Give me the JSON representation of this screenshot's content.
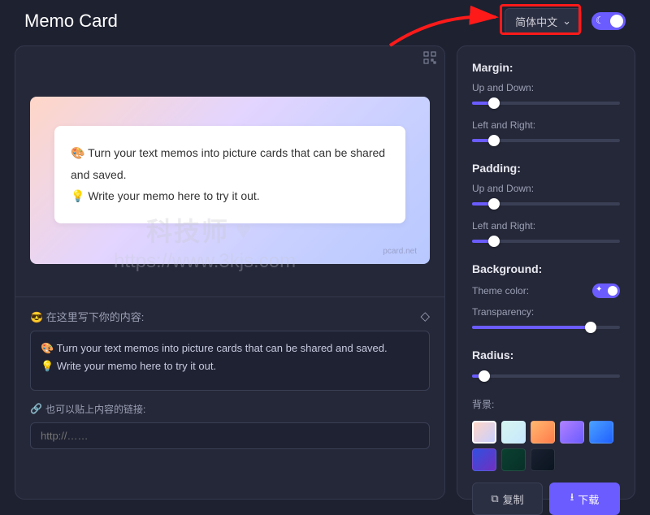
{
  "header": {
    "title": "Memo Card",
    "lang_label": "简体中文"
  },
  "preview": {
    "line1": "🎨 Turn your text memos into picture cards that can be shared and saved.",
    "line2": "💡 Write your memo here to try it out.",
    "watermark": "pcard.net"
  },
  "editor": {
    "label": "😎 在这里写下你的内容:",
    "content_line1": "🎨 Turn your text memos into picture cards that can be shared and saved.",
    "content_line2": "💡 Write your memo here to try it out.",
    "link_label": "也可以贴上内容的链接:",
    "link_placeholder": "http://……"
  },
  "settings": {
    "margin_title": "Margin:",
    "margin_ud_label": "Up and Down:",
    "margin_ud_value": 15,
    "margin_lr_label": "Left and Right:",
    "margin_lr_value": 15,
    "padding_title": "Padding:",
    "padding_ud_label": "Up and Down:",
    "padding_ud_value": 15,
    "padding_lr_label": "Left and Right:",
    "padding_lr_value": 15,
    "background_title": "Background:",
    "theme_color_label": "Theme color:",
    "transparency_label": "Transparency:",
    "transparency_value": 80,
    "radius_title": "Radius:",
    "radius_value": 8,
    "swatch_title": "背景:",
    "swatches": [
      "linear-gradient(135deg,#ffd6c7,#c8d0ff)",
      "linear-gradient(135deg,#d5f5f0,#c8e8ff)",
      "linear-gradient(135deg,#ffb870,#ff7b4a)",
      "linear-gradient(135deg,#b080ff,#6b5cff)",
      "linear-gradient(135deg,#4aa0ff,#2060ff)",
      "linear-gradient(135deg,#3050e0,#7030c0)",
      "linear-gradient(135deg,#0a4030,#083028)",
      "linear-gradient(135deg,#1a2030,#0a1420)"
    ],
    "selected_swatch": 0
  },
  "actions": {
    "copy_label": "复制",
    "download_label": "下载"
  },
  "overlay": {
    "brand": "科技师",
    "url": "https://www.3kjs.com"
  }
}
